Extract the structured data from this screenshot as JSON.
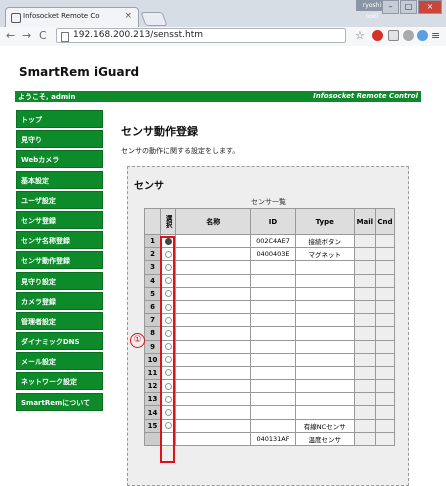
{
  "browser": {
    "tab_title": "Infosocket Remote Co",
    "user_badge": "ryoshi ooki",
    "url": "192.168.200.213/sensst.htm",
    "back": "←",
    "forward": "→",
    "reload": "C",
    "tab_close": "×",
    "min": "–",
    "max": "□",
    "close": "×",
    "star": "☆",
    "menu": "≡"
  },
  "header": {
    "brand": "SmartRem iGuard",
    "welcome": "ようこそ, admin",
    "remote_control": "Infosocket Remote Control"
  },
  "sidebar": {
    "items": [
      {
        "label": "トップ"
      },
      {
        "label": "見守り"
      },
      {
        "label": "Webカメラ"
      },
      {
        "label": "基本設定"
      },
      {
        "label": "ユーザ設定"
      },
      {
        "label": "センサ登録"
      },
      {
        "label": "センサ名称登録"
      },
      {
        "label": "センサ動作登録"
      },
      {
        "label": "見守り設定"
      },
      {
        "label": "カメラ登録"
      },
      {
        "label": "管理者設定"
      },
      {
        "label": "ダイナミックDNS"
      },
      {
        "label": "メール設定"
      },
      {
        "label": "ネットワーク設定"
      },
      {
        "label": "SmartRemについて"
      }
    ]
  },
  "main": {
    "title": "センサ動作登録",
    "description": "センサの動作に関する設定をします。",
    "panel_title": "センサ",
    "table_caption": "センサ一覧",
    "columns": {
      "select": "選択",
      "name": "名称",
      "id": "ID",
      "type": "Type",
      "mail": "Mail",
      "cnd": "Cnd"
    },
    "rows": [
      {
        "num": "1",
        "id": "002C4AE7",
        "type": "接続ボタン",
        "selected": true
      },
      {
        "num": "2",
        "id": "0400403E",
        "type": "マグネット",
        "selected": false
      },
      {
        "num": "3",
        "id": "",
        "type": "",
        "selected": false
      },
      {
        "num": "4",
        "id": "",
        "type": "",
        "selected": false
      },
      {
        "num": "5",
        "id": "",
        "type": "",
        "selected": false
      },
      {
        "num": "6",
        "id": "",
        "type": "",
        "selected": false
      },
      {
        "num": "7",
        "id": "",
        "type": "",
        "selected": false
      },
      {
        "num": "8",
        "id": "",
        "type": "",
        "selected": false
      },
      {
        "num": "9",
        "id": "",
        "type": "",
        "selected": false
      },
      {
        "num": "10",
        "id": "",
        "type": "",
        "selected": false
      },
      {
        "num": "11",
        "id": "",
        "type": "",
        "selected": false
      },
      {
        "num": "12",
        "id": "",
        "type": "",
        "selected": false
      },
      {
        "num": "13",
        "id": "",
        "type": "",
        "selected": false
      },
      {
        "num": "14",
        "id": "",
        "type": "",
        "selected": false
      },
      {
        "num": "15",
        "id": "",
        "type": "有線NCセンサ",
        "selected": false
      },
      {
        "num": "",
        "id": "040131AF",
        "type": "温度センサ",
        "selected": false
      }
    ]
  },
  "annotation": {
    "marker": "①",
    "color": "#e0111b"
  },
  "colors": {
    "brand_green": "#0d8a2a"
  }
}
